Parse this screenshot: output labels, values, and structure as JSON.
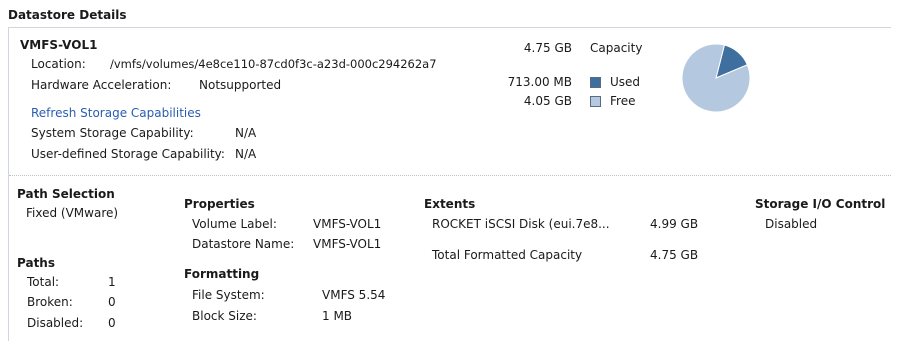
{
  "header": {
    "title": "Datastore Details"
  },
  "summary": {
    "name": "VMFS-VOL1",
    "location_label": "Location:",
    "location_value": "/vmfs/volumes/4e8ce110-87cd0f3c-a23d-000c294262a7",
    "hw_accel_label": "Hardware Acceleration:",
    "hw_accel_value": "Notsupported",
    "refresh_link": "Refresh Storage Capabilities",
    "system_cap_label": "System Storage Capability:",
    "system_cap_value": "N/A",
    "user_cap_label": "User-defined Storage Capability:",
    "user_cap_value": "N/A"
  },
  "capacity": {
    "total": "4.75 GB",
    "total_label": "Capacity",
    "used": "713.00 MB",
    "used_label": "Used",
    "free": "4.05 GB",
    "free_label": "Free",
    "used_color": "#3f6f9f",
    "free_color": "#b4c8df"
  },
  "chart_data": {
    "type": "pie",
    "categories": [
      "Used",
      "Free"
    ],
    "values": [
      713.0,
      4147.2
    ],
    "colors": [
      "#3f6f9f",
      "#b4c8df"
    ]
  },
  "path_selection": {
    "title": "Path Selection",
    "value": "Fixed (VMware)"
  },
  "paths": {
    "title": "Paths",
    "rows": [
      {
        "label": "Total:",
        "value": "1"
      },
      {
        "label": "Broken:",
        "value": "0"
      },
      {
        "label": "Disabled:",
        "value": "0"
      }
    ]
  },
  "properties": {
    "title": "Properties",
    "volume_label_label": "Volume Label:",
    "volume_label_value": "VMFS-VOL1",
    "datastore_name_label": "Datastore Name:",
    "datastore_name_value": "VMFS-VOL1"
  },
  "formatting": {
    "title": "Formatting",
    "file_system_label": "File System:",
    "file_system_value": "VMFS 5.54",
    "block_size_label": "Block Size:",
    "block_size_value": "1 MB"
  },
  "extents": {
    "title": "Extents",
    "disk_name": "ROCKET iSCSI Disk (eui.7e8...",
    "disk_size": "4.99 GB",
    "total_label": "Total Formatted Capacity",
    "total_value": "4.75 GB"
  },
  "storage_io": {
    "title": "Storage I/O Control",
    "value": "Disabled"
  }
}
